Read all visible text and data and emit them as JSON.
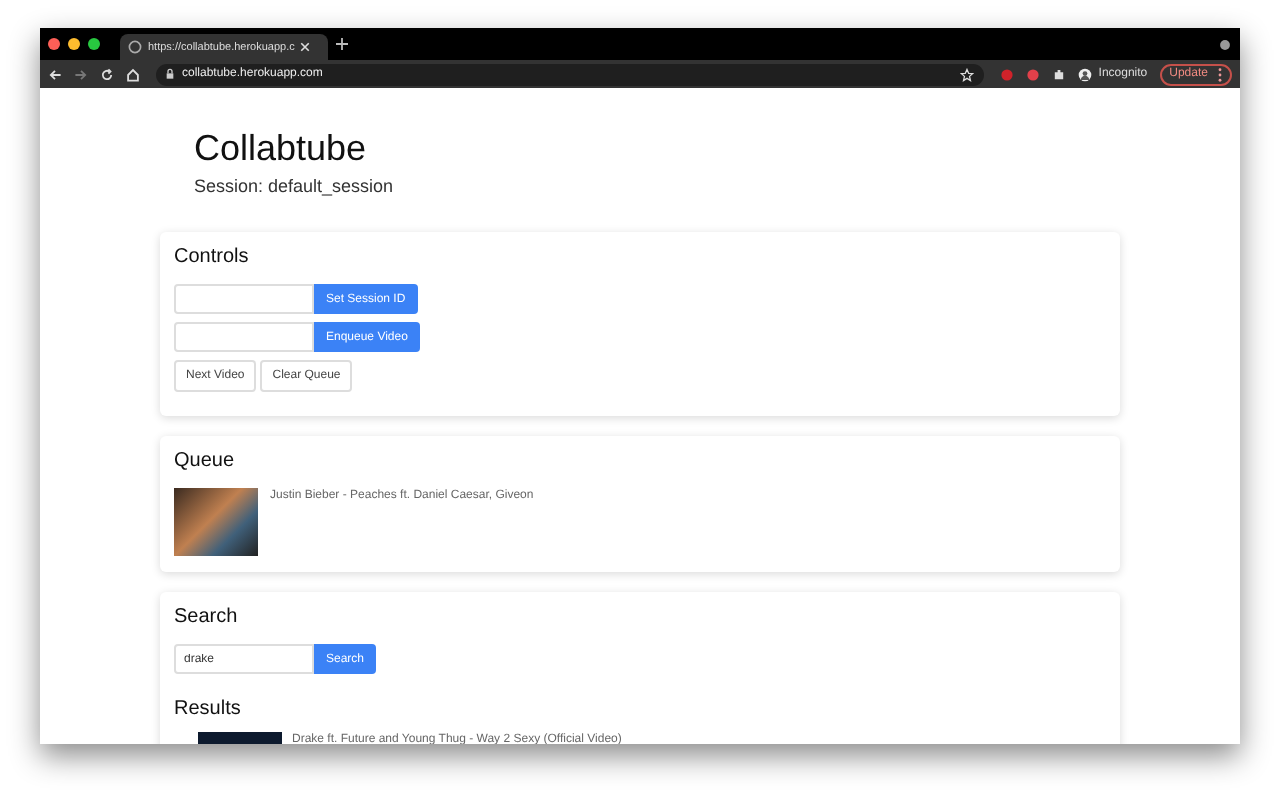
{
  "browser": {
    "tab_title": "https://collabtube.herokuapp.c",
    "address": "collabtube.herokuapp.com",
    "profile_label": "Incognito",
    "update_button": "Update"
  },
  "header": {
    "title": "Collabtube",
    "session": "Session: default_session"
  },
  "controls": {
    "title": "Controls",
    "session_button": "Set Session ID",
    "enqueue_button": "Enqueue Video",
    "next_button": "Next Video",
    "clear_button": "Clear Queue"
  },
  "queue": {
    "title": "Queue",
    "items": [
      {
        "title": "Justin Bieber - Peaches ft. Daniel Caesar, Giveon"
      }
    ]
  },
  "search": {
    "title": "Search",
    "value": "drake",
    "button": "Search",
    "results_title": "Results",
    "results": [
      {
        "title": "Drake ft. Future and Young Thug - Way 2 Sexy (Official Video)"
      }
    ]
  }
}
